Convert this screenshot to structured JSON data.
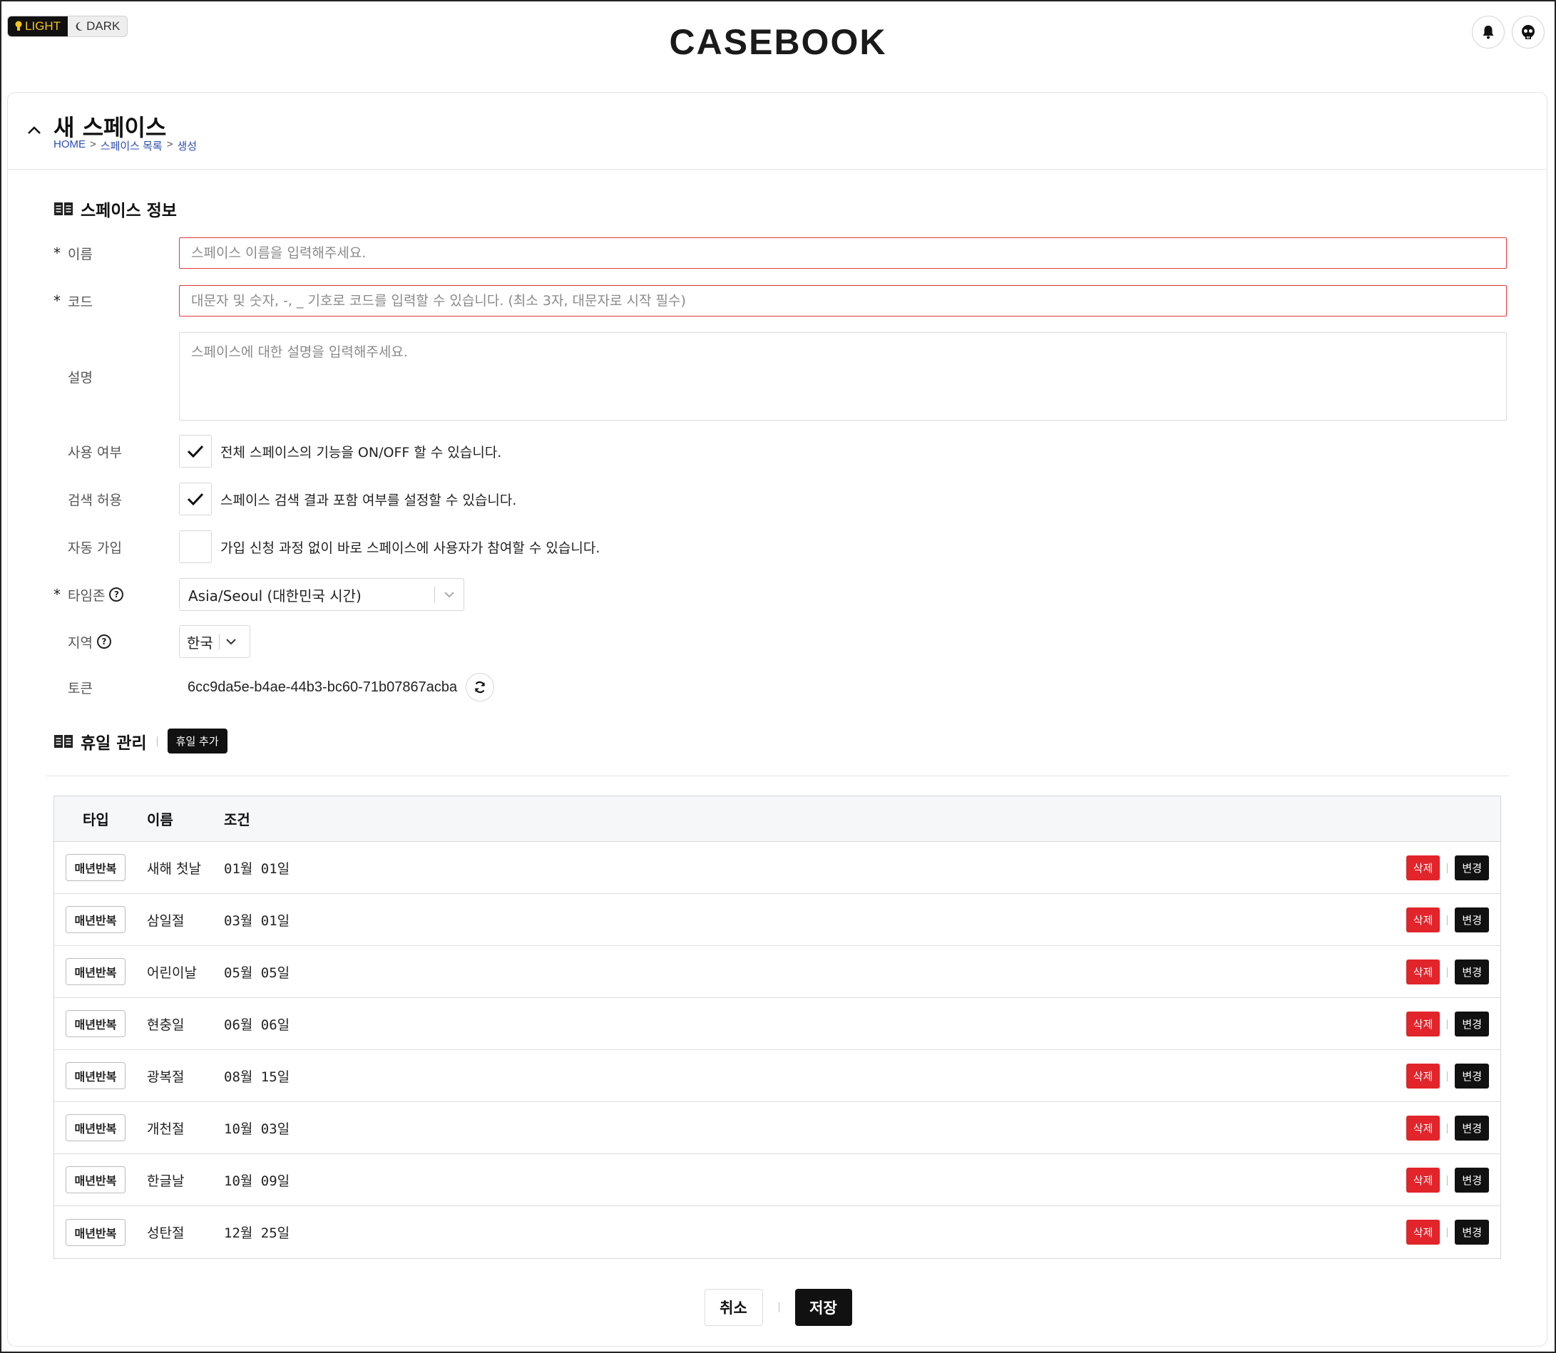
{
  "theme": {
    "light_label": "LIGHT",
    "dark_label": "DARK"
  },
  "brand": {
    "logo": "CASEBOOK"
  },
  "header": {
    "title": "새 스페이스",
    "breadcrumb": [
      "HOME",
      "스페이스 목록",
      "생성"
    ],
    "breadcrumb_sep": ">"
  },
  "space_info": {
    "section_title": "스페이스 정보",
    "name": {
      "label": "이름",
      "required_mark": "*",
      "placeholder": "스페이스 이름을 입력해주세요.",
      "value": ""
    },
    "code": {
      "label": "코드",
      "required_mark": "*",
      "placeholder": "대문자 및 숫자, -, _ 기호로 코드를 입력할 수 있습니다. (최소 3자, 대문자로 시작 필수)",
      "value": ""
    },
    "description": {
      "label": "설명",
      "placeholder": "스페이스에 대한 설명을 입력해주세요.",
      "value": ""
    },
    "enabled": {
      "label": "사용 여부",
      "checked": true,
      "text": "전체 스페이스의 기능을 ON/OFF 할 수 있습니다."
    },
    "searchable": {
      "label": "검색 허용",
      "checked": true,
      "text": "스페이스 검색 결과 포함 여부를 설정할 수 있습니다."
    },
    "auto_join": {
      "label": "자동 가입",
      "checked": false,
      "text": "가입 신청 과정 없이 바로 스페이스에 사용자가 참여할 수 있습니다."
    },
    "timezone": {
      "label": "타임존",
      "required_mark": "*",
      "value": "Asia/Seoul (대한민국 시간)"
    },
    "region": {
      "label": "지역",
      "value": "한국"
    },
    "token": {
      "label": "토큰",
      "value": "6cc9da5e-b4ae-44b3-bc60-71b07867acba"
    }
  },
  "holidays": {
    "section_title": "휴일 관리",
    "add_label": "휴일 추가",
    "columns": [
      "타입",
      "이름",
      "조건"
    ],
    "delete_label": "삭제",
    "edit_label": "변경",
    "rows": [
      {
        "type": "매년반복",
        "name": "새해 첫날",
        "condition": "01월 01일"
      },
      {
        "type": "매년반복",
        "name": "삼일절",
        "condition": "03월 01일"
      },
      {
        "type": "매년반복",
        "name": "어린이날",
        "condition": "05월 05일"
      },
      {
        "type": "매년반복",
        "name": "현충일",
        "condition": "06월 06일"
      },
      {
        "type": "매년반복",
        "name": "광복절",
        "condition": "08월 15일"
      },
      {
        "type": "매년반복",
        "name": "개천절",
        "condition": "10월 03일"
      },
      {
        "type": "매년반복",
        "name": "한글날",
        "condition": "10월 09일"
      },
      {
        "type": "매년반복",
        "name": "성탄절",
        "condition": "12월 25일"
      }
    ]
  },
  "footer": {
    "cancel_label": "취소",
    "save_label": "저장"
  },
  "colors": {
    "required_border": "#e0383e",
    "delete": "#e2242b",
    "primary": "#111111",
    "theme_accent": "#f5c518"
  }
}
